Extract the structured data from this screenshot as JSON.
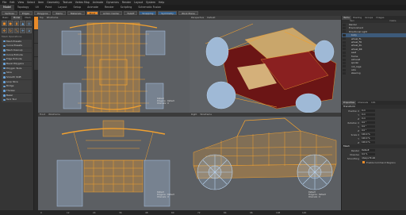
{
  "menubar": {
    "items": [
      "File",
      "Edit",
      "View",
      "Select",
      "Item",
      "Geometry",
      "Texture",
      "Vertex Map",
      "Animate",
      "Dynamics",
      "Render",
      "Layout",
      "System",
      "Help"
    ]
  },
  "layout_tabs": [
    "Model",
    "Topology",
    "UV",
    "Paint",
    "Layout",
    "Setup",
    "Animate",
    "Render",
    "Scripting",
    "Schematic Fusion"
  ],
  "layout_tabs_active": 0,
  "toolbar": {
    "buttons": [
      "Vertices",
      "Edges",
      "Polygons",
      "Items",
      "Materials",
      "Pivot",
      "Action Center",
      "Falloff",
      "Snapping",
      "Symmetry",
      "Work Plane"
    ]
  },
  "left_panel": {
    "tabs": [
      "Basic",
      "Model",
      "Mesh"
    ],
    "sections": [
      "Mesh Operations",
      "Vertex",
      "Edge",
      "Polygon"
    ],
    "items": [
      "Mesh Presets",
      "Curve Presets",
      "Mesh Cleanup",
      "Curve Extrude",
      "Edge Extrude",
      "Bevel Polygons",
      "Polygon Tools",
      "Slice",
      "Smooth Shift",
      "Loop Slice",
      "Bridge",
      "Thicken",
      "Bezel",
      "Tack Tool"
    ]
  },
  "viewports": {
    "top_left": {
      "title": "Top",
      "mode": "Wireframe",
      "shading": "Wireframe"
    },
    "top_right": {
      "title": "Perspective",
      "mode": "Default",
      "shading": "Advanced"
    },
    "bottom_left": {
      "title": "Front",
      "mode": "Wireframe",
      "shading": "Wireframe"
    },
    "bottom_right": {
      "title": "Right",
      "mode": "Wireframe",
      "shading": "Wireframe"
    }
  },
  "stats": {
    "label": "Default",
    "lines": [
      "Polygons : Default",
      "Channels : 0",
      "Deformers : OFF",
      "GL : 117,360"
    ]
  },
  "right_panel": {
    "tabs": [
      "Items",
      "Shading",
      "Groups",
      "Images"
    ],
    "columns": [
      "Item",
      "Visible"
    ],
    "items": [
      "Render",
      "Environment",
      "Directional Light",
      "body",
      "wheel_FL",
      "wheel_FR",
      "wheel_RL",
      "wheel_RR",
      "seat",
      "frame",
      "exhaust",
      "spoiler",
      "roll_cage",
      "axle",
      "steering"
    ],
    "selected_index": 3,
    "properties_tabs": [
      "Properties",
      "Channels",
      "Info"
    ],
    "transform_header": "Transform",
    "props": [
      {
        "label": "Position X",
        "value": "0 m"
      },
      {
        "label": "Y",
        "value": "0 m"
      },
      {
        "label": "Z",
        "value": "0 m"
      },
      {
        "label": "Rotation X",
        "value": "0.0 °"
      },
      {
        "label": "Y",
        "value": "0.0 °"
      },
      {
        "label": "Z",
        "value": "0.0 °"
      },
      {
        "label": "Scale X",
        "value": "100.0 %"
      },
      {
        "label": "Y",
        "value": "100.0 %"
      },
      {
        "label": "Z",
        "value": "100.0 %"
      }
    ],
    "mesh_header": "Mesh",
    "mesh_props": [
      {
        "label": "Render",
        "value": "Default"
      },
      {
        "label": "Dissolve",
        "value": "0.0 %"
      },
      {
        "label": "Smoothing",
        "value": "Always Enabled"
      }
    ],
    "checkbox_label": "Enable Command Regions"
  },
  "timeline": {
    "labels": [
      "0",
      "12",
      "24",
      "36",
      "48",
      "60",
      "72",
      "84",
      "96",
      "108",
      "120"
    ]
  },
  "colors": {
    "accent": "#e98b2a",
    "wire": "#f0a030",
    "wheel": "#a9c6e6",
    "body": "#7a1a1a"
  }
}
